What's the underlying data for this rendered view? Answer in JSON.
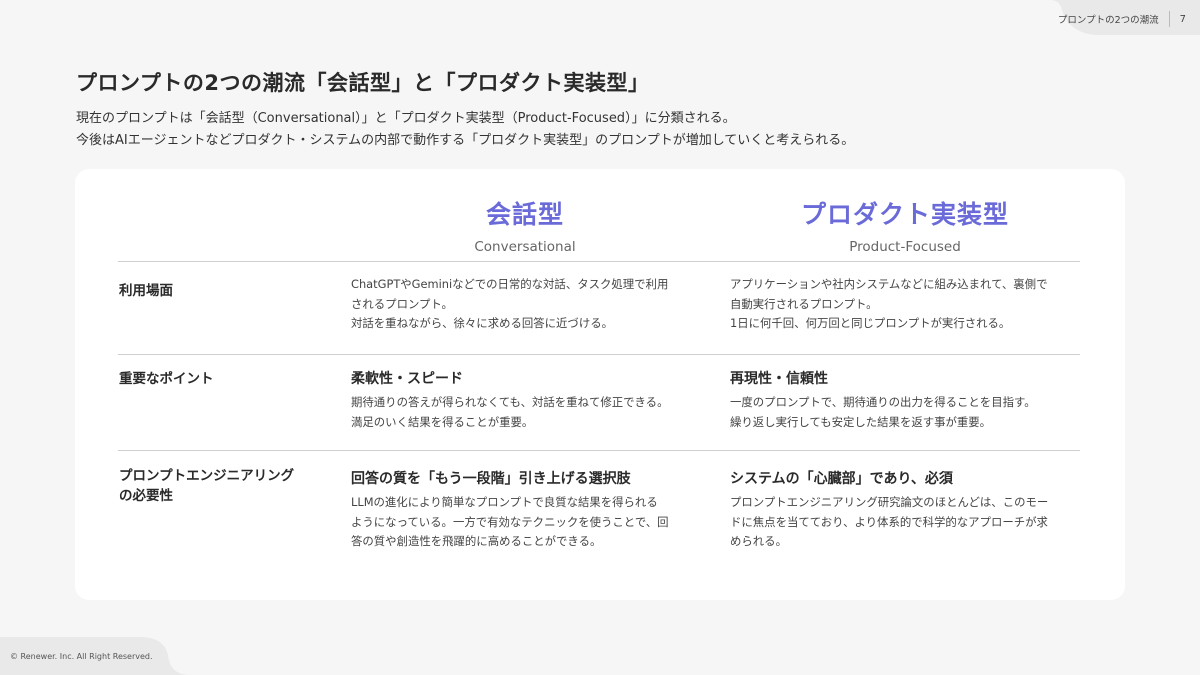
{
  "header": {
    "section_title": "プロンプトの2つの潮流",
    "page_number": "7"
  },
  "title": "プロンプトの2つの潮流「会話型」と「プロダクト実装型」",
  "intro": {
    "line1": "現在のプロンプトは「会話型（Conversational）」と「プロダクト実装型（Product-Focused）」に分類される。",
    "line2": "今後はAIエージェントなどプロダクト・システムの内部で動作する「プロダクト実装型」のプロンプトが増加していくと考えられる。"
  },
  "columns": [
    {
      "title": "会話型",
      "subtitle": "Conversational"
    },
    {
      "title": "プロダクト実装型",
      "subtitle": "Product-Focused"
    }
  ],
  "rows": [
    {
      "label": "利用場面",
      "a": {
        "head": "",
        "body": "ChatGPTやGeminiなどでの日常的な対話、タスク処理で利用\nされるプロンプト。\n対話を重ねながら、徐々に求める回答に近づける。"
      },
      "b": {
        "head": "",
        "body": "アプリケーションや社内システムなどに組み込まれて、裏側で\n自動実行されるプロンプト。\n1日に何千回、何万回と同じプロンプトが実行される。"
      }
    },
    {
      "label": "重要なポイント",
      "a": {
        "head": "柔軟性・スピード",
        "body": "期待通りの答えが得られなくても、対話を重ねて修正できる。\n満足のいく結果を得ることが重要。"
      },
      "b": {
        "head": "再現性・信頼性",
        "body": "一度のプロンプトで、期待通りの出力を得ることを目指す。\n繰り返し実行しても安定した結果を返す事が重要。"
      }
    },
    {
      "label_line1": "プロンプトエンジニアリング",
      "label_line2": "の必要性",
      "a": {
        "head": "回答の質を「もう一段階」引き上げる選択肢",
        "body": "LLMの進化により簡単なプロンプトで良質な結果を得られる\nようになっている。一方で有効なテクニックを使うことで、回\n答の質や創造性を飛躍的に高めることができる。"
      },
      "b": {
        "head": "システムの「心臓部」であり、必須",
        "body": "プロンプトエンジニアリング研究論文のほとんどは、このモー\nドに焦点を当てており、より体系的で科学的なアプローチが求\nめられる。"
      }
    }
  ],
  "footer": "© Renewer. Inc. All Right Reserved.",
  "colors": {
    "accent": "#6a6ad8",
    "card": "#ffffff",
    "background": "#f6f6f7"
  }
}
